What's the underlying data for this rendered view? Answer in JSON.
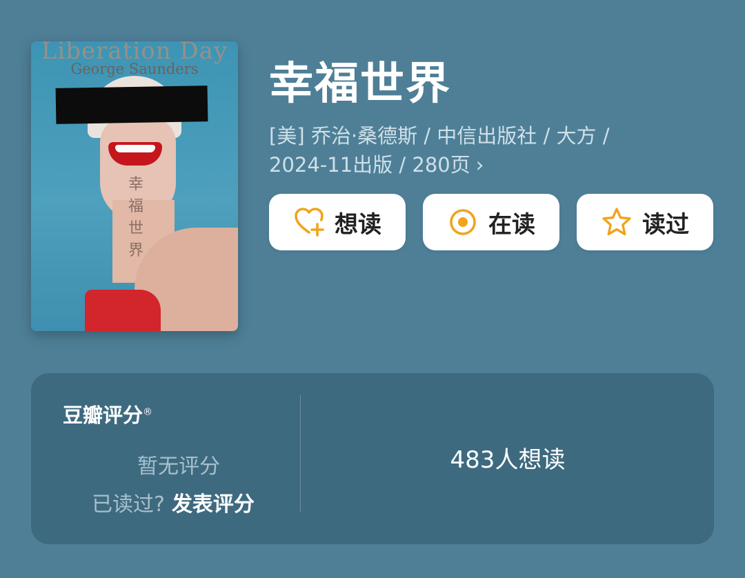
{
  "book": {
    "cover": {
      "title_en": "Liberation Day",
      "author_en": "George Saunders",
      "title_cn_chars": [
        "幸",
        "福",
        "世",
        "界"
      ]
    },
    "title": "幸福世界",
    "meta_line1": "[美] 乔治·桑德斯 / 中信出版社 / 大方 /",
    "meta_line2": "2024-11出版 / 280页",
    "meta_chevron": "›"
  },
  "actions": [
    {
      "label": "想读",
      "icon": "heart-plus-icon"
    },
    {
      "label": "在读",
      "icon": "reading-circle-icon"
    },
    {
      "label": "读过",
      "icon": "star-outline-icon"
    }
  ],
  "rating": {
    "title": "豆瓣评分",
    "title_mark": "®",
    "no_rating": "暂无评分",
    "have_read": "已读过?",
    "publish_link": "发表评分",
    "wish_count": "483人想读"
  },
  "colors": {
    "background": "#4e7f97",
    "panel": "#3e6a80",
    "accent": "#f0a41c"
  }
}
